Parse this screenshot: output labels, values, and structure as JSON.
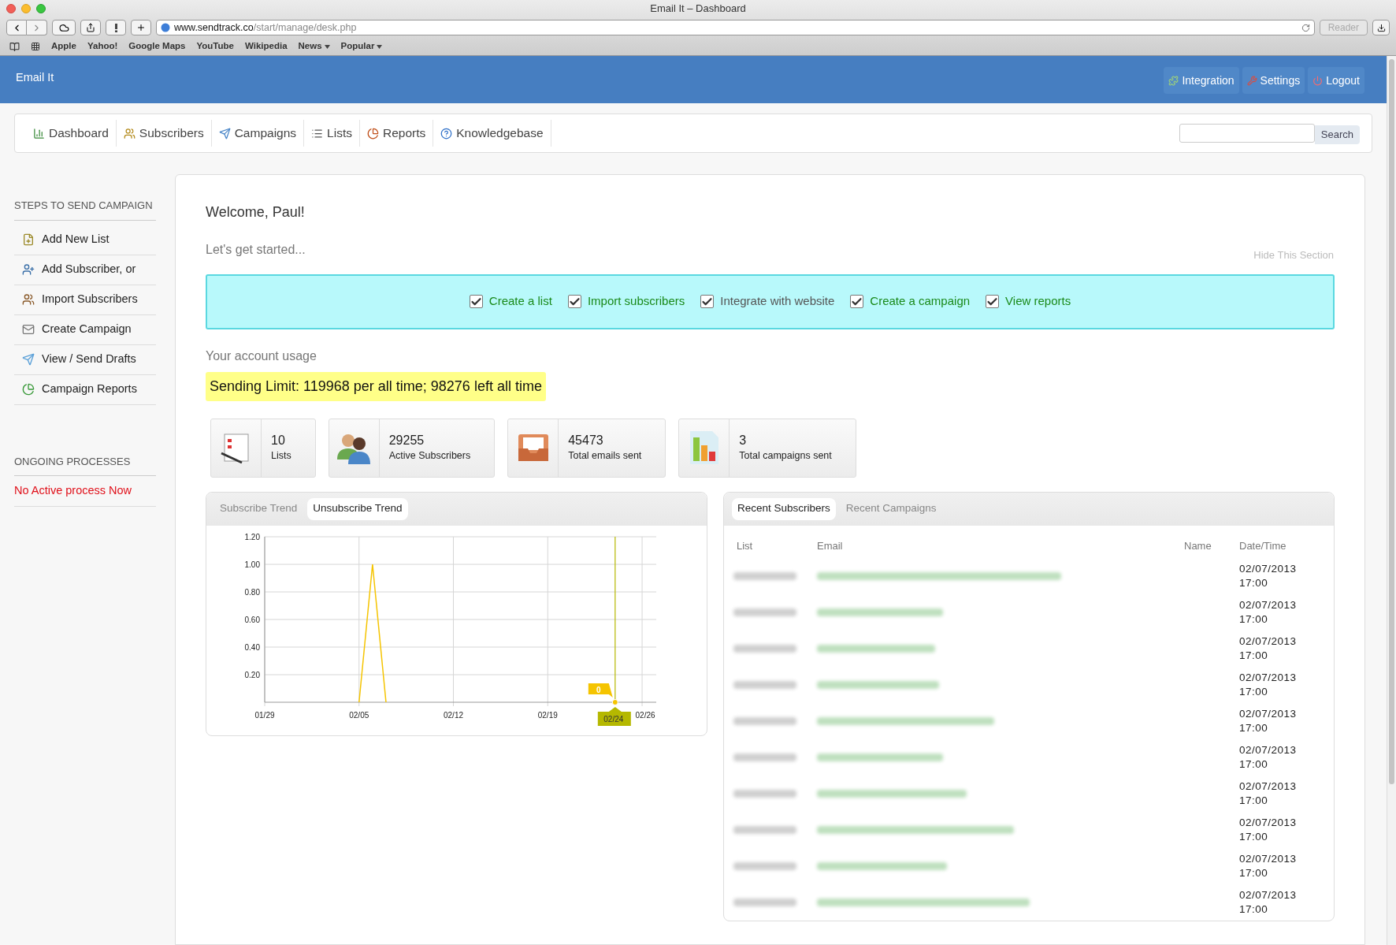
{
  "browser": {
    "title": "Email It – Dashboard",
    "url_host": "www.sendtrack.co",
    "url_path": "/start/manage/desk.php",
    "reader": {
      "label": "Reader",
      "disabled": true
    },
    "bookmarks": [
      {
        "label": "Apple",
        "kind": "link"
      },
      {
        "label": "Yahoo!",
        "kind": "link"
      },
      {
        "label": "Google Maps",
        "kind": "link"
      },
      {
        "label": "YouTube",
        "kind": "link"
      },
      {
        "label": "Wikipedia",
        "kind": "link"
      },
      {
        "label": "News",
        "kind": "menu"
      },
      {
        "label": "Popular",
        "kind": "menu"
      }
    ]
  },
  "header": {
    "brand": "Email It",
    "actions": [
      {
        "label": "Integration"
      },
      {
        "label": "Settings"
      },
      {
        "label": "Logout"
      }
    ]
  },
  "nav": {
    "items": [
      {
        "label": "Dashboard"
      },
      {
        "label": "Subscribers"
      },
      {
        "label": "Campaigns"
      },
      {
        "label": "Lists"
      },
      {
        "label": "Reports"
      },
      {
        "label": "Knowledgebase"
      }
    ],
    "search_button": "Search"
  },
  "sidebar": {
    "steps_title": "STEPS TO SEND CAMPAIGN",
    "steps": [
      {
        "label": "Add New List"
      },
      {
        "label": "Add Subscriber, or"
      },
      {
        "label": "Import Subscribers"
      },
      {
        "label": "Create Campaign"
      },
      {
        "label": "View / Send Drafts"
      },
      {
        "label": "Campaign Reports"
      }
    ],
    "processes_title": "ONGOING PROCESSES",
    "processes_status": "No Active process Now"
  },
  "welcome": {
    "title": "Welcome, Paul!",
    "subtitle": "Let's get started...",
    "hide": "Hide This Section",
    "checklist": [
      {
        "label": "Create a list",
        "checked": true,
        "link": true
      },
      {
        "label": "Import subscribers",
        "checked": true,
        "link": true
      },
      {
        "label": "Integrate with website",
        "checked": true,
        "link": false
      },
      {
        "label": "Create a campaign",
        "checked": true,
        "link": true
      },
      {
        "label": "View reports",
        "checked": true,
        "link": true
      }
    ]
  },
  "usage": {
    "title": "Your account usage",
    "limit": "Sending Limit: 119968 per all time; 98276 left all time",
    "stats": [
      {
        "kind": "lists",
        "value": "10",
        "label": "Lists"
      },
      {
        "kind": "subscribers",
        "value": "29255",
        "label": "Active Subscribers"
      },
      {
        "kind": "emails",
        "value": "45473",
        "label": "Total emails sent"
      },
      {
        "kind": "campaigns",
        "value": "3",
        "label": "Total campaigns sent"
      }
    ]
  },
  "trend": {
    "tabs": [
      {
        "label": "Subscribe Trend",
        "selected": false
      },
      {
        "label": "Unsubscribe Trend",
        "selected": true
      }
    ],
    "chart_data": {
      "type": "line",
      "categories": [
        "01/29",
        null,
        null,
        null,
        null,
        null,
        null,
        "02/05",
        null,
        null,
        null,
        null,
        null,
        null,
        "02/12",
        null,
        null,
        null,
        null,
        null,
        null,
        "02/19",
        null,
        null,
        null,
        null,
        "02/24",
        null,
        "02/26"
      ],
      "series": [
        {
          "color": "#f5c400",
          "values": [
            null,
            null,
            null,
            null,
            null,
            null,
            null,
            0,
            1,
            0,
            null,
            null,
            null,
            null,
            null,
            null,
            null,
            null,
            null,
            null,
            null,
            null,
            null,
            null,
            null,
            null,
            0,
            null,
            null
          ]
        }
      ],
      "ylim": [
        0,
        1.2
      ],
      "yticks": [
        {
          "value": 0.2,
          "label": "0.20"
        },
        {
          "value": 0.4,
          "label": "0.40"
        },
        {
          "value": 0.6,
          "label": "0.60"
        },
        {
          "value": 0.8,
          "label": "0.80"
        },
        {
          "value": 1,
          "label": "1.00"
        },
        {
          "value": 1.2,
          "label": "1.20"
        }
      ],
      "grid": true,
      "annotations": [
        {
          "x": "02/24",
          "y": 0,
          "text": "0"
        }
      ]
    }
  },
  "recent": {
    "tabs": [
      {
        "label": "Recent Subscribers",
        "selected": true
      },
      {
        "label": "Recent Campaigns",
        "selected": false
      }
    ],
    "columns": [
      "List",
      "Email",
      "Name",
      "Date/Time"
    ],
    "rows": [
      {
        "datetime": "02/07/2013 17:00"
      },
      {
        "datetime": "02/07/2013 17:00"
      },
      {
        "datetime": "02/07/2013 17:00"
      },
      {
        "datetime": "02/07/2013 17:00"
      },
      {
        "datetime": "02/07/2013 17:00"
      },
      {
        "datetime": "02/07/2013 17:00"
      },
      {
        "datetime": "02/07/2013 17:00"
      },
      {
        "datetime": "02/07/2013 17:00"
      },
      {
        "datetime": "02/07/2013 17:00"
      },
      {
        "datetime": "02/07/2013 17:00"
      }
    ]
  }
}
